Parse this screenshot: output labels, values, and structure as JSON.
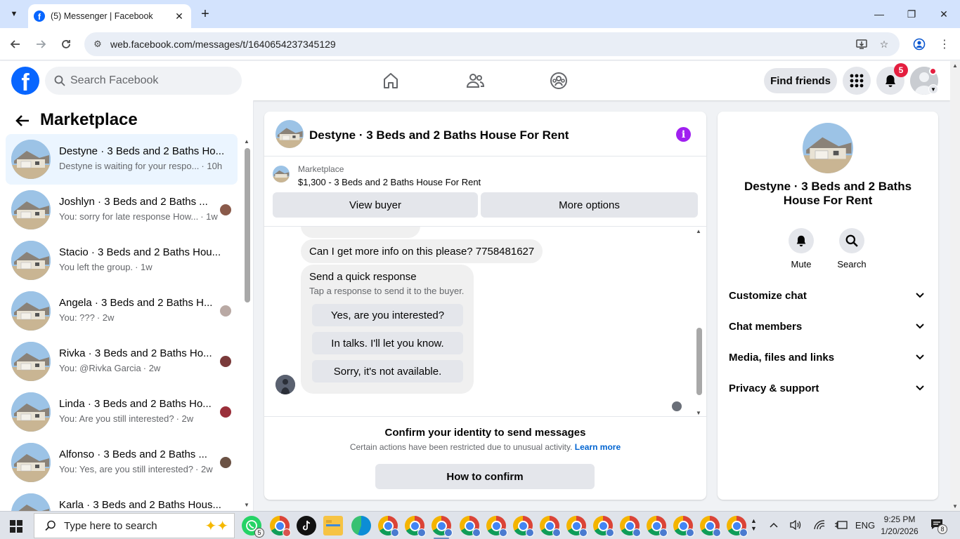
{
  "browser": {
    "tab_title": "(5) Messenger | Facebook",
    "url": "web.facebook.com/messages/t/1640654237345129"
  },
  "header": {
    "search_placeholder": "Search Facebook",
    "find_friends": "Find friends",
    "notification_count": "5"
  },
  "left": {
    "title": "Marketplace",
    "conversations": [
      {
        "name": "Destyne · 3 Beds and 2 Baths Ho...",
        "preview": "Destyne is waiting for your respo...",
        "time": "· 10h"
      },
      {
        "name": "Joshlyn · 3 Beds and 2 Baths ...",
        "preview": "You: sorry for late response How...",
        "time": "· 1w"
      },
      {
        "name": "Stacio · 3 Beds and 2 Baths Hou...",
        "preview": "You left the group.",
        "time": "· 1w"
      },
      {
        "name": "Angela · 3 Beds and 2 Baths H...",
        "preview": "You: ???",
        "time": "· 2w"
      },
      {
        "name": "Rivka · 3 Beds and 2 Baths Ho...",
        "preview": "You: @Rivka Garcia",
        "time": "· 2w"
      },
      {
        "name": "Linda · 3 Beds and 2 Baths Ho...",
        "preview": "You: Are you still interested?",
        "time": "· 2w"
      },
      {
        "name": "Alfonso · 3 Beds and 2 Baths ...",
        "preview": "You: Yes, are you still interested?",
        "time": "· 2w"
      },
      {
        "name": "Karla · 3 Beds and 2 Baths Hous...",
        "preview": "",
        "time": ""
      }
    ]
  },
  "chat": {
    "title": "Destyne · 3 Beds and 2 Baths House For Rent",
    "listing_category": "Marketplace",
    "listing_desc": "$1,300 - 3 Beds and 2 Baths House For Rent",
    "view_buyer": "View buyer",
    "more_options": "More options",
    "message": "Can I get more info on this please? 7758481627",
    "quick_title": "Send a quick response",
    "quick_sub": "Tap a response to send it to the buyer.",
    "quick_options": [
      "Yes, are you interested?",
      "In talks. I'll let you know.",
      "Sorry, it's not available."
    ],
    "confirm_title": "Confirm your identity to send messages",
    "confirm_sub": "Certain actions have been restricted due to unusual activity.",
    "learn_more": "Learn more",
    "how_to_confirm": "How to confirm"
  },
  "right": {
    "name": "Destyne · 3 Beds and 2 Baths House For Rent",
    "mute": "Mute",
    "search": "Search",
    "sections": [
      "Customize chat",
      "Chat members",
      "Media, files and links",
      "Privacy & support"
    ]
  },
  "taskbar": {
    "search_placeholder": "Type here to search",
    "whatsapp_badge": "5",
    "language": "ENG",
    "time": "9:25 PM",
    "date": "1/20/2026",
    "notification_count": "8"
  }
}
